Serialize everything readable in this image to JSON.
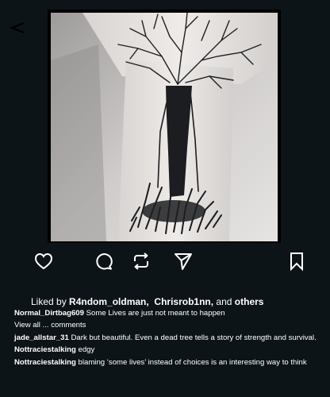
{
  "colors": {
    "background": "#0d1418",
    "text": "#ffffff",
    "photo_frame": "#000000"
  },
  "icons": {
    "back": "chevron-left-icon",
    "like": "heart-icon",
    "comment": "speech-bubble-icon",
    "repost": "repost-icon",
    "share": "paper-plane-icon",
    "save": "bookmark-icon"
  },
  "post": {
    "image_alt": "",
    "likes": {
      "prefix": "Liked by",
      "user1": "R4ndom_oldman,",
      "user2": "Chrisrob1nn,",
      "and_text": "and",
      "others": "others"
    },
    "view_all_label": "View all ... comments",
    "comments": [
      {
        "user": "Normal_Dirtbag609",
        "text": "Some Lives are just not meant to happen"
      },
      {
        "user": "jade_allstar_31",
        "text": "Dark but beautiful. Even a dead tree tells a story of strength and survival."
      },
      {
        "user": "Nottraciestalking",
        "text": "edgy"
      },
      {
        "user": "Nottraciestalking",
        "text": "blaming ‘some lives’ instead of choices is an interesting way to think"
      }
    ]
  }
}
